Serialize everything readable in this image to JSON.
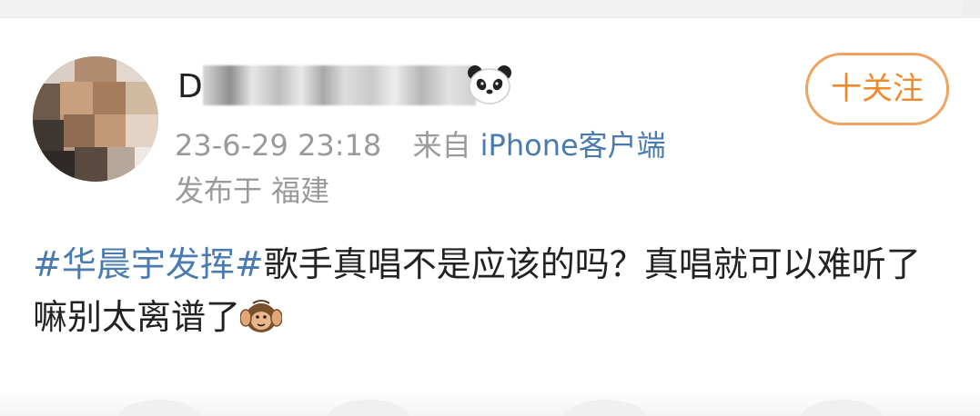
{
  "post": {
    "username_visible_char": "D",
    "username_badge_icon": "panda-emoji-icon",
    "follow_button_label": "十关注",
    "timestamp": "23-6-29 23:18",
    "source_prefix": "来自",
    "source_client": "iPhone客户端",
    "location": "发布于 福建",
    "hashtag": "#华晨宇发挥#",
    "body_text": "歌手真唱不是应该的吗？真唱就可以难听了嘛别太离谱了",
    "trailing_emoji": "hear-no-evil-monkey-emoji-icon"
  },
  "colors": {
    "link_blue": "#4a7bb0",
    "follow_orange": "#f08a2f",
    "meta_gray": "#9a9a9a",
    "body_text": "#222222"
  }
}
